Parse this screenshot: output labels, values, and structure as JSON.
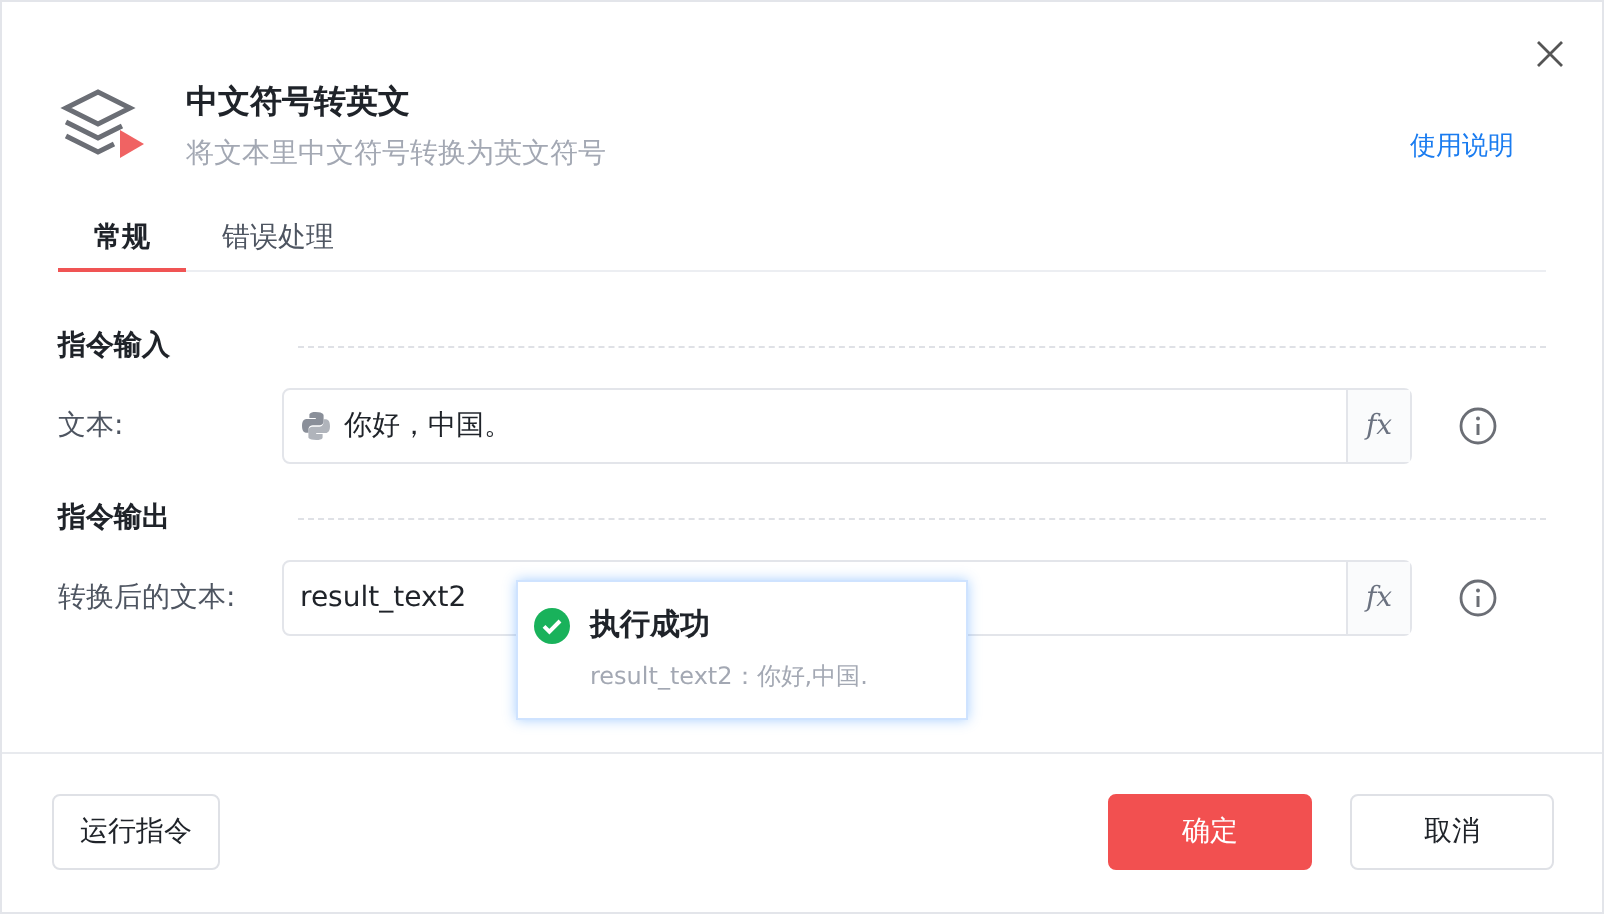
{
  "header": {
    "title": "中文符号转英文",
    "subtitle": "将文本里中文符号转换为英文符号",
    "help_link": "使用说明"
  },
  "tabs": [
    {
      "label": "常规",
      "selected": true
    },
    {
      "label": "错误处理",
      "selected": false
    }
  ],
  "sections": [
    {
      "title": "指令输入",
      "fields": [
        {
          "label": "文本:",
          "value": "你好，中国。",
          "kind": "python",
          "fx": "fx"
        }
      ]
    },
    {
      "title": "指令输出",
      "fields": [
        {
          "label": "转换后的文本:",
          "value": "result_text2",
          "kind": "plain",
          "fx": "fx"
        }
      ]
    }
  ],
  "toast": {
    "title": "执行成功",
    "message": "result_text2：你好,中国."
  },
  "footer": {
    "run_button": "运行指令",
    "ok_button": "确定",
    "cancel_button": "取消"
  }
}
